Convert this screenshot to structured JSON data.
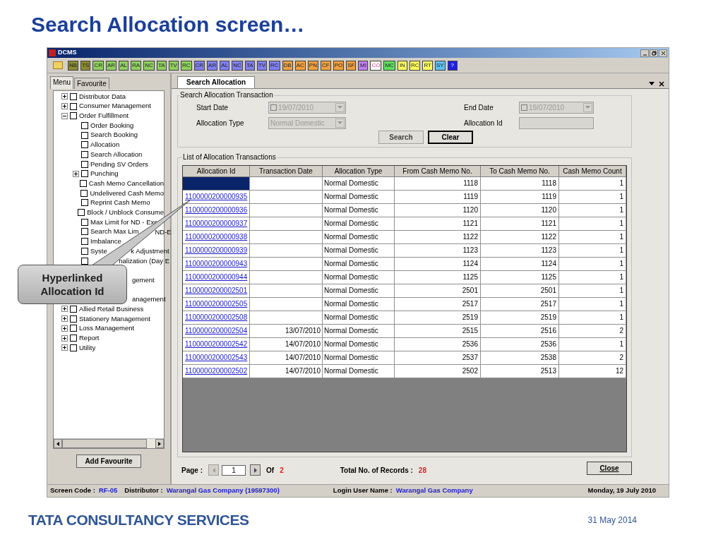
{
  "slide": {
    "title": "Search Allocation screen…",
    "footer_logo": "TATA CONSULTANCY SERVICES",
    "date": "31 May 2014"
  },
  "window": {
    "title": "DCMS"
  },
  "toolbar": [
    {
      "label": "NB",
      "color": "#8c8c30"
    },
    {
      "label": "TS",
      "color": "#8c8c30"
    },
    {
      "label": "CR",
      "color": "#8fd060"
    },
    {
      "label": "AR",
      "color": "#8fd060"
    },
    {
      "label": "AL",
      "color": "#8fd060"
    },
    {
      "label": "RA",
      "color": "#8fd060"
    },
    {
      "label": "NC",
      "color": "#8fd060"
    },
    {
      "label": "TA",
      "color": "#8fd060"
    },
    {
      "label": "TV",
      "color": "#8fd060"
    },
    {
      "label": "RC",
      "color": "#8fd060"
    },
    {
      "label": "CR",
      "color": "#8080f0"
    },
    {
      "label": "AR",
      "color": "#8080f0"
    },
    {
      "label": "AL",
      "color": "#8080f0"
    },
    {
      "label": "NC",
      "color": "#8080f0"
    },
    {
      "label": "TA",
      "color": "#8080f0"
    },
    {
      "label": "TV",
      "color": "#8080f0"
    },
    {
      "label": "RC",
      "color": "#8080f0"
    },
    {
      "label": "DB",
      "color": "#f0a040"
    },
    {
      "label": "AC",
      "color": "#f0a040"
    },
    {
      "label": "PN",
      "color": "#f0a040"
    },
    {
      "label": "CF",
      "color": "#f0a040"
    },
    {
      "label": "PO",
      "color": "#f0a040"
    },
    {
      "label": "SF",
      "color": "#f0a040"
    },
    {
      "label": "MI",
      "color": "#c080f0"
    },
    {
      "label": "CO",
      "color": "#ffffff"
    },
    {
      "label": "MC",
      "color": "#60e060"
    },
    {
      "label": "IN",
      "color": "#ffff60"
    },
    {
      "label": "RC",
      "color": "#ffff60"
    },
    {
      "label": "RT",
      "color": "#ffff60"
    },
    {
      "label": "SY",
      "color": "#60c0f0"
    },
    {
      "label": "?",
      "color": "#2020e0"
    }
  ],
  "menu_tabs": [
    {
      "label": "Menu",
      "selected": true
    },
    {
      "label": "Favourite",
      "selected": false
    }
  ],
  "tree": [
    {
      "label": "Distributor Data",
      "checked": false,
      "expanded": false
    },
    {
      "label": "Consumer Management",
      "checked": false,
      "expanded": false
    },
    {
      "label": "Order Fulfillment",
      "checked": false,
      "expanded": true,
      "children": [
        {
          "label": "Order Booking",
          "checked": false
        },
        {
          "label": "Search Booking",
          "checked": false
        },
        {
          "label": "Allocation",
          "checked": false
        },
        {
          "label": "Search Allocation",
          "checked": false
        },
        {
          "label": "Pending SV Orders",
          "checked": false
        },
        {
          "label": "Punching",
          "checked": false,
          "expanded": false
        },
        {
          "label": "Cash Memo Cancellation",
          "checked": false
        },
        {
          "label": "Undelivered Cash Memo",
          "checked": false
        },
        {
          "label": "Reprint Cash Memo",
          "checked": false
        },
        {
          "label": "Block / Unblock Consume",
          "checked": false
        },
        {
          "label": "Max Limit for ND - Exe",
          "checked": false
        },
        {
          "label": "Search Max Lim",
          "after": "ND-E",
          "checked": false
        },
        {
          "label": "Imbalance",
          "checked": false
        },
        {
          "label": "Syste",
          "after": "k Adjustment",
          "checked": false
        },
        {
          "after": "nalization (Day E",
          "checked": false
        }
      ]
    },
    {
      "after": "gement",
      "covered": true
    },
    {
      "after": "anagement",
      "covered": true
    },
    {
      "label": "Allied Retail Business",
      "checked": false,
      "expanded": false
    },
    {
      "label": "Stationery Management",
      "checked": false,
      "expanded": false
    },
    {
      "label": "Loss Management",
      "checked": false,
      "expanded": false
    },
    {
      "label": "Report",
      "checked": false,
      "expanded": false
    },
    {
      "label": "Utility",
      "checked": false,
      "expanded": false
    }
  ],
  "add_favourite": "Add Favourite",
  "doc_tabs": [
    {
      "label": "Search Allocation",
      "selected": true
    }
  ],
  "search": {
    "legend": "Search Allocation Transaction",
    "disabled": true,
    "start_date_label": "Start Date",
    "start_date": "19/07/2010",
    "end_date_label": "End Date",
    "end_date": "19/07/2010",
    "allocation_type_label": "Allocation Type",
    "allocation_type": "Normal Domestic",
    "allocation_id_label": "Allocation Id",
    "buttons": [
      {
        "label": "Search",
        "default": false
      },
      {
        "label": "Clear",
        "default": true
      }
    ]
  },
  "table": {
    "legend": "List of Allocation Transactions",
    "columns": [
      "Allocation Id",
      "Transaction Date",
      "Allocation Type",
      "From Cash Memo No.",
      "To Cash Memo No.",
      "Cash Memo Count"
    ],
    "rows": [
      {
        "selected": true,
        "type": "Normal Domestic",
        "from": "1118",
        "to": "1118",
        "count": "1"
      },
      {
        "selected": false,
        "id": "1100000200000935",
        "type": "Normal Domestic",
        "from": "1119",
        "to": "1119",
        "count": "1"
      },
      {
        "selected": false,
        "id": "1100000200000936",
        "type": "Normal Domestic",
        "from": "1120",
        "to": "1120",
        "count": "1"
      },
      {
        "selected": false,
        "id": "1100000200000937",
        "type": "Normal Domestic",
        "from": "1121",
        "to": "1121",
        "count": "1"
      },
      {
        "selected": false,
        "id": "1100000200000938",
        "type": "Normal Domestic",
        "from": "1122",
        "to": "1122",
        "count": "1"
      },
      {
        "selected": false,
        "id": "1100000200000939",
        "type": "Normal Domestic",
        "from": "1123",
        "to": "1123",
        "count": "1"
      },
      {
        "selected": false,
        "id": "1100000200000943",
        "type": "Normal Domestic",
        "from": "1124",
        "to": "1124",
        "count": "1"
      },
      {
        "selected": false,
        "id": "1100000200000944",
        "type": "Normal Domestic",
        "from": "1125",
        "to": "1125",
        "count": "1"
      },
      {
        "selected": false,
        "id": "1100000200002501",
        "type": "Normal Domestic",
        "from": "2501",
        "to": "2501",
        "count": "1"
      },
      {
        "selected": false,
        "id": "1100000200002505",
        "type": "Normal Domestic",
        "from": "2517",
        "to": "2517",
        "count": "1"
      },
      {
        "selected": false,
        "id": "1100000200002508",
        "type": "Normal Domestic",
        "from": "2519",
        "to": "2519",
        "count": "1"
      },
      {
        "selected": false,
        "id": "1100000200002504",
        "date": "13/07/2010",
        "type": "Normal Domestic",
        "from": "2515",
        "to": "2516",
        "count": "2"
      },
      {
        "selected": false,
        "id": "1100000200002542",
        "date": "14/07/2010",
        "type": "Normal Domestic",
        "from": "2536",
        "to": "2536",
        "count": "1"
      },
      {
        "selected": false,
        "id": "1100000200002543",
        "date": "14/07/2010",
        "type": "Normal Domestic",
        "from": "2537",
        "to": "2538",
        "count": "2"
      },
      {
        "selected": false,
        "id": "1100000200002502",
        "date": "14/07/2010",
        "type": "Normal Domestic",
        "from": "2502",
        "to": "2513",
        "count": "12"
      }
    ]
  },
  "pager": {
    "label": "Page :",
    "page": "1",
    "of_label": "Of",
    "total_pages": "2",
    "records_label": "Total No. of Records :",
    "records": "28",
    "close": "Close"
  },
  "status_bar": {
    "items": [
      {
        "label": "Screen Code :",
        "value": "RF-05"
      },
      {
        "label": "Distributor :",
        "value": "Warangal Gas Company (19597300)"
      },
      {
        "label": "Login User Name :",
        "value": "Warangal Gas Company"
      }
    ],
    "date": "Monday, 19 July 2010"
  },
  "callout": {
    "text": "Hyperlinked Allocation Id"
  }
}
